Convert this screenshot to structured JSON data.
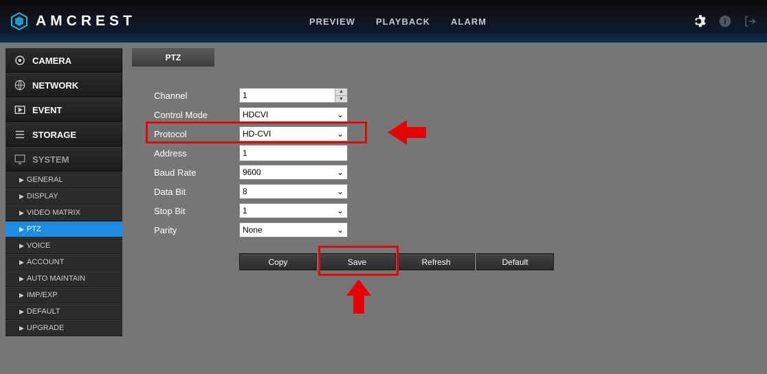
{
  "brand": "AMCREST",
  "nav": {
    "preview": "PREVIEW",
    "playback": "PLAYBACK",
    "alarm": "ALARM"
  },
  "sidebar": {
    "camera": "CAMERA",
    "network": "NETWORK",
    "event": "EVENT",
    "storage": "STORAGE",
    "system": "SYSTEM",
    "subs": {
      "general": "GENERAL",
      "display": "DISPLAY",
      "video_matrix": "VIDEO MATRIX",
      "ptz": "PTZ",
      "voice": "VOICE",
      "account": "ACCOUNT",
      "auto_maintain": "AUTO MAINTAIN",
      "imp_exp": "IMP/EXP",
      "default": "DEFAULT",
      "upgrade": "UPGRADE"
    }
  },
  "tab": {
    "ptz": "PTZ"
  },
  "form": {
    "channel": {
      "label": "Channel",
      "value": "1"
    },
    "control_mode": {
      "label": "Control Mode",
      "value": "HDCVI"
    },
    "protocol": {
      "label": "Protocol",
      "value": "HD-CVI"
    },
    "address": {
      "label": "Address",
      "value": "1"
    },
    "baud_rate": {
      "label": "Baud Rate",
      "value": "9600"
    },
    "data_bit": {
      "label": "Data Bit",
      "value": "8"
    },
    "stop_bit": {
      "label": "Stop Bit",
      "value": "1"
    },
    "parity": {
      "label": "Parity",
      "value": "None"
    }
  },
  "buttons": {
    "copy": "Copy",
    "save": "Save",
    "refresh": "Refresh",
    "default": "Default"
  }
}
